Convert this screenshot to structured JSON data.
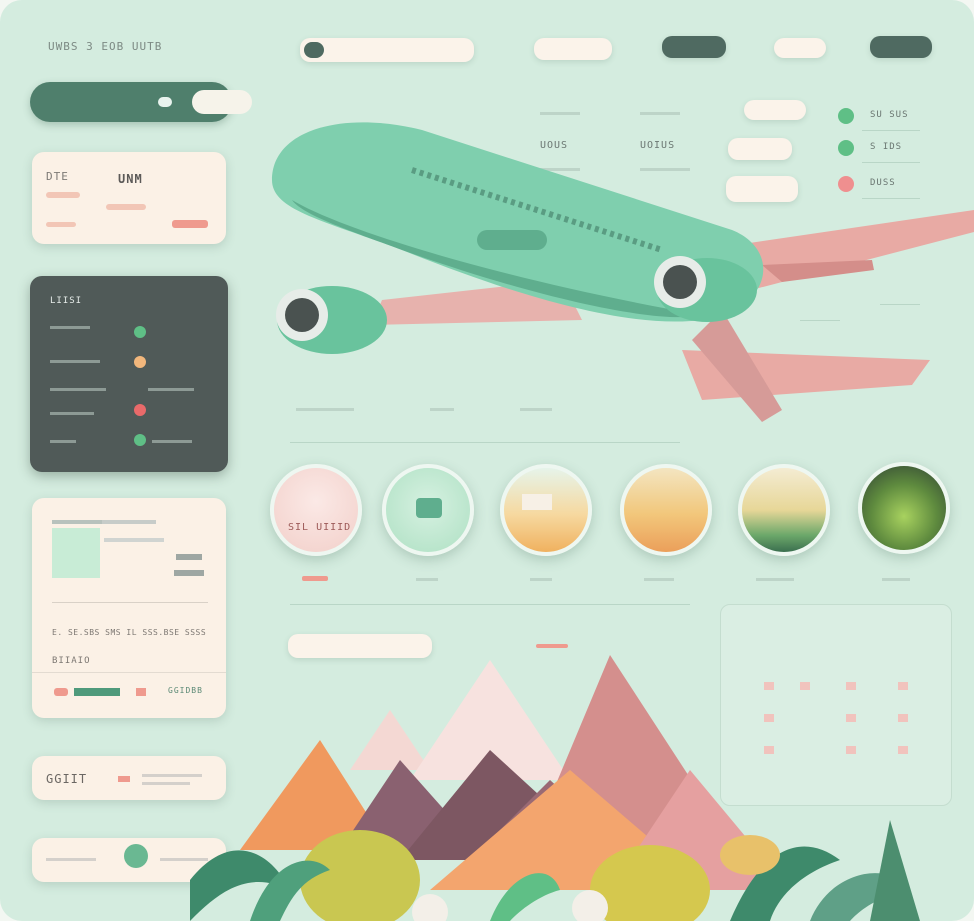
{
  "header": {
    "brand": "UWBS 3 EOB UUTB",
    "tabs": [
      "",
      "",
      "",
      "",
      ""
    ]
  },
  "toggle": {
    "label": "",
    "state": "on"
  },
  "ticket_card": {
    "code_a": "DTE",
    "code_b": "UNM"
  },
  "dark_panel": {
    "title": "LIISI",
    "items": [
      {
        "color": "#5fbf86"
      },
      {
        "color": "#f2b77c"
      },
      {
        "color": "#e96a6a"
      },
      {
        "color": "#5fbf86"
      }
    ]
  },
  "booking_card": {
    "line1": "E. SE.SBS SMS IL SSS.BSE SSSS",
    "line2": "BIIAIO",
    "action": "GGIDBB"
  },
  "promo": {
    "code": "GGIIT"
  },
  "hero": {
    "col1": "UOUS",
    "col2": "UOIUS",
    "legend": [
      {
        "label": "SU SUS",
        "color": "#5fbf86"
      },
      {
        "label": "S IDS",
        "color": "#5fbf86"
      },
      {
        "label": "DUSS",
        "color": "#ef8f8f"
      }
    ]
  },
  "destinations": [
    {
      "caption": "",
      "label": "SIL UIIID"
    },
    {
      "caption": "",
      "label": ""
    },
    {
      "caption": "",
      "label": ""
    },
    {
      "caption": "",
      "label": ""
    },
    {
      "caption": "",
      "label": ""
    },
    {
      "caption": "",
      "label": ""
    }
  ],
  "search": {
    "placeholder": ""
  },
  "colors": {
    "background": "#d4ecdf",
    "plane": "#7fcfae",
    "wing": "#e6a9a7",
    "dark_panel": "#505a58",
    "card": "#fbf1e6"
  }
}
